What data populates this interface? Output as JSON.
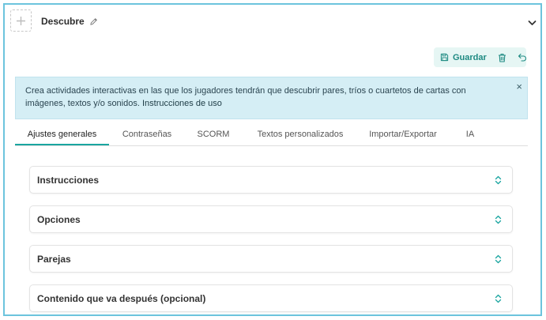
{
  "block": {
    "title": "Descubre",
    "add_icon": "plus-icon",
    "edit_icon": "pencil-icon",
    "collapse_icon": "chevron-down-icon"
  },
  "toolbar": {
    "save_label": "Guardar",
    "save_icon": "floppy-disk-icon",
    "delete_icon": "trash-icon",
    "undo_icon": "undo-icon"
  },
  "alert": {
    "text": "Crea actividades interactivas en las que los jugadores tendrán que descubrir pares, tríos o cuartetos de cartas con imágenes, textos y/o sonidos.",
    "link_text": "Instrucciones de uso",
    "close": "×"
  },
  "tabs": [
    {
      "label": "Ajustes generales",
      "active": true
    },
    {
      "label": "Contraseñas",
      "active": false
    },
    {
      "label": "SCORM",
      "active": false
    },
    {
      "label": "Textos personalizados",
      "active": false
    },
    {
      "label": "Importar/Exportar",
      "active": false
    },
    {
      "label": "IA",
      "active": false
    }
  ],
  "sections": [
    {
      "label": "Instrucciones"
    },
    {
      "label": "Opciones"
    },
    {
      "label": "Parejas"
    },
    {
      "label": "Contenido que va después (opcional)"
    }
  ],
  "colors": {
    "accent": "#1aa5a0",
    "frame_border": "#6cc4dd",
    "alert_bg": "#d5eef5",
    "toolbar_bg": "#e6f6f4"
  }
}
